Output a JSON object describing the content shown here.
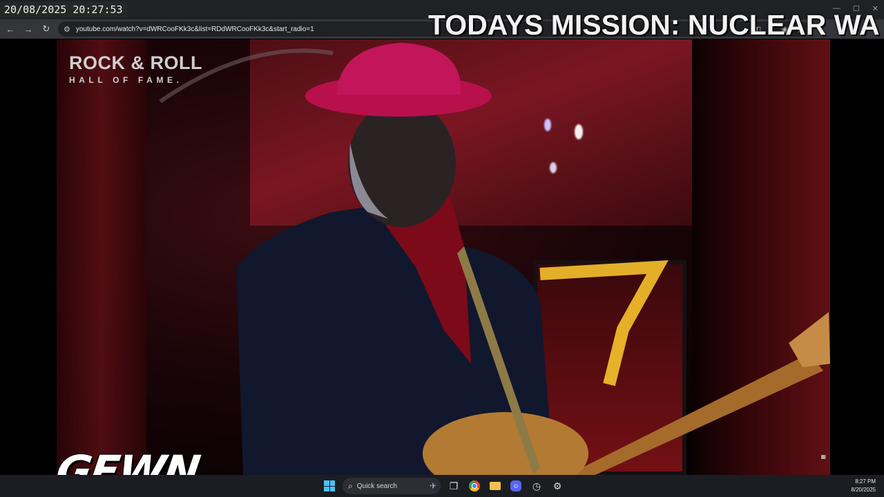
{
  "browser": {
    "url": "youtube.com/watch?v=dWRCooFKk3c&list=RDdWRCooFKk3c&start_radio=1",
    "back_icon": "arrow-left-icon",
    "forward_icon": "arrow-right-icon",
    "reload_icon": "reload-icon"
  },
  "video": {
    "logo_line1": "ROCK & ROLL",
    "logo_line2": "HALL OF FAME."
  },
  "overlay": {
    "timestamp": "20/08/2025 20:27:53",
    "mission": "TODAYS MISSION: NUCLEAR WA",
    "brand": "GEWN"
  },
  "taskbar": {
    "search_label": "Quick search",
    "time": "8:27 PM",
    "date": "8/20/2025"
  },
  "colors": {
    "taskbar_bg": "#1c1d22",
    "windows_accent": "#4cc2ff",
    "stage_red": "#7a1622"
  }
}
